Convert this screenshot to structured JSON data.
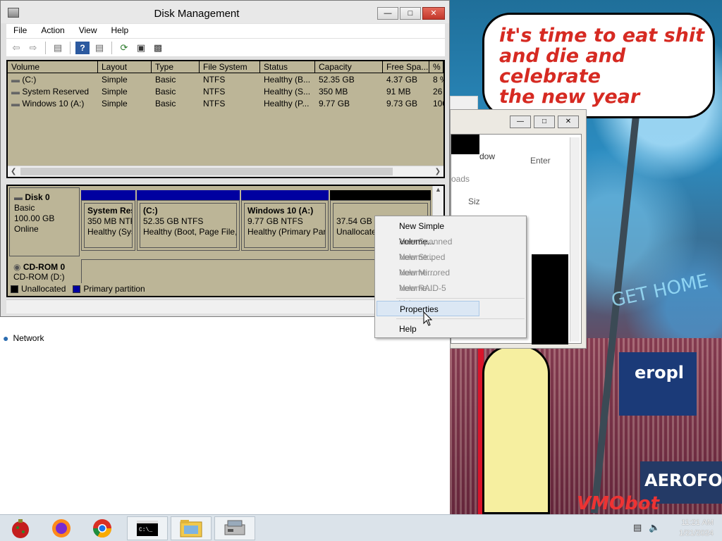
{
  "window": {
    "title": "Disk Management",
    "menu": [
      "File",
      "Action",
      "View",
      "Help"
    ]
  },
  "volume_list": {
    "columns": [
      "Volume",
      "Layout",
      "Type",
      "File System",
      "Status",
      "Capacity",
      "Free Spa...",
      "% F"
    ],
    "rows": [
      [
        "(C:)",
        "Simple",
        "Basic",
        "NTFS",
        "Healthy (B...",
        "52.35 GB",
        "4.37 GB",
        "8 %"
      ],
      [
        "System Reserved",
        "Simple",
        "Basic",
        "NTFS",
        "Healthy (S...",
        "350 MB",
        "91 MB",
        "26"
      ],
      [
        "Windows 10 (A:)",
        "Simple",
        "Basic",
        "NTFS",
        "Healthy (P...",
        "9.77 GB",
        "9.73 GB",
        "100"
      ]
    ]
  },
  "disk0": {
    "name": "Disk 0",
    "type": "Basic",
    "size": "100.00 GB",
    "status": "Online",
    "partitions": [
      {
        "name": "System Res",
        "size": "350 MB NTF",
        "status": "Healthy (Sys"
      },
      {
        "name": "(C:)",
        "size": "52.35 GB NTFS",
        "status": "Healthy (Boot, Page File,"
      },
      {
        "name": "Windows 10  (A:)",
        "size": "9.77 GB NTFS",
        "status": "Healthy (Primary Par"
      },
      {
        "name": "",
        "size": "37.54 GB",
        "status": "Unallocate"
      }
    ]
  },
  "cdrom": {
    "name": "CD-ROM 0",
    "drive": "CD-ROM (D:)"
  },
  "legend": {
    "unallocated": "Unallocated",
    "primary": "Primary partition"
  },
  "context_menu": {
    "items": [
      {
        "label": "New Simple Volume...",
        "enabled": true
      },
      {
        "label": "New Spanned Volume...",
        "enabled": false
      },
      {
        "label": "New Striped Volume...",
        "enabled": false
      },
      {
        "label": "New Mirrored Volume...",
        "enabled": false
      },
      {
        "label": "New RAID-5 Volume...",
        "enabled": false
      },
      {
        "label": "Properties",
        "enabled": true,
        "highlighted": true
      },
      {
        "label": "Help",
        "enabled": true
      }
    ]
  },
  "background_window": {
    "fragments": [
      "dow",
      "Enter",
      "oads",
      "Siz"
    ]
  },
  "desktop": {
    "network_label": "Network"
  },
  "wallpaper": {
    "speech_lines": [
      "it's time to eat shit",
      "and die and celebrate",
      "the new year"
    ],
    "sign_text": "GET HOME",
    "brand_text": "VMObot",
    "aero_text": "AEROFOS",
    "erop_text": "eropl"
  },
  "taskbar": {
    "time": "11:21 AM",
    "date": "1/21/2024",
    "apps": [
      "ornament",
      "firefox",
      "chrome",
      "command-prompt",
      "file-explorer",
      "disk-management"
    ]
  },
  "colors": {
    "primary_partition": "#0000a0",
    "unallocated": "#000000",
    "pane_bg": "#bcb597",
    "speech_text": "#d62a22"
  }
}
